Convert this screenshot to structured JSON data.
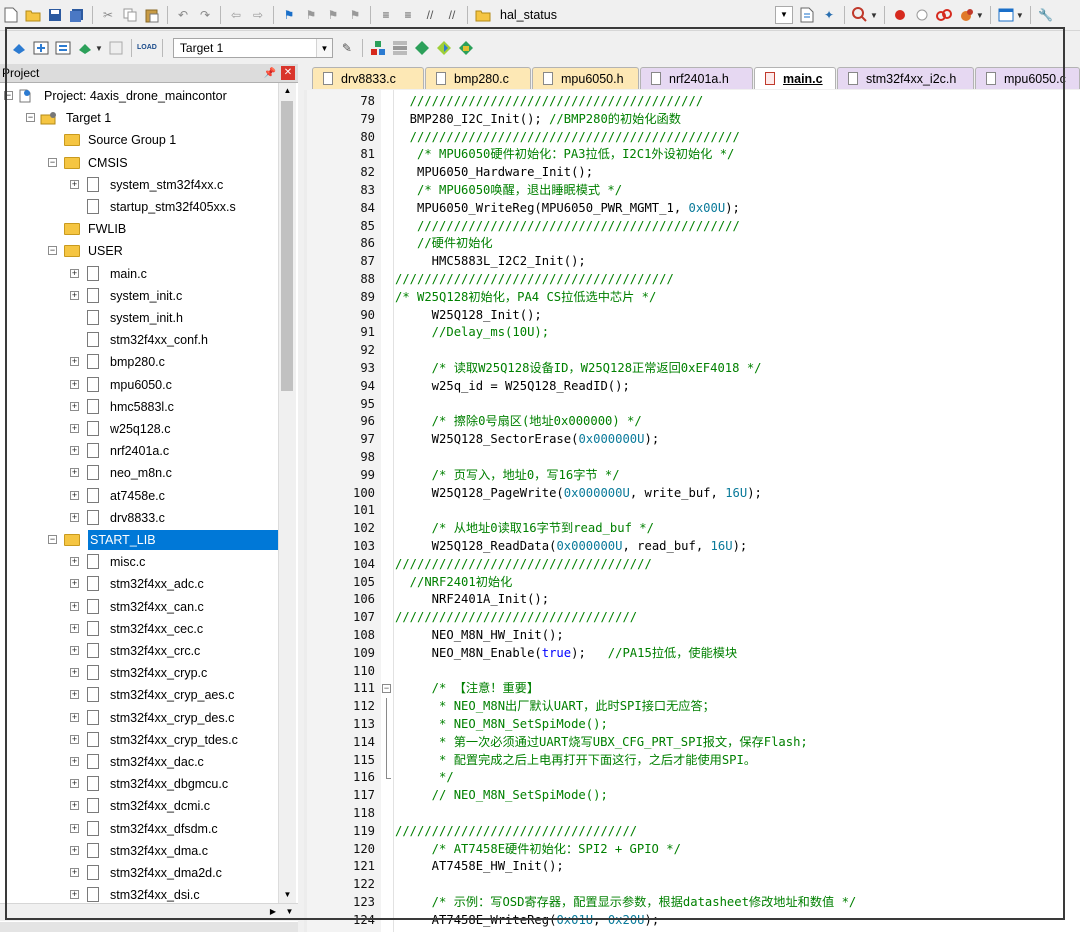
{
  "toolbar": {
    "search_value": "hal_status",
    "target_select": "Target 1"
  },
  "project_panel": {
    "title": "Project",
    "tree": [
      {
        "label": "Project: 4axis_drone_maincontor",
        "depth": 0,
        "type": "project",
        "expander": "-"
      },
      {
        "label": "Target 1",
        "depth": 1,
        "type": "target",
        "expander": "-"
      },
      {
        "label": "Source Group 1",
        "depth": 2,
        "type": "folder",
        "expander": ""
      },
      {
        "label": "CMSIS",
        "depth": 2,
        "type": "folder",
        "expander": "-"
      },
      {
        "label": "system_stm32f4xx.c",
        "depth": 3,
        "type": "file",
        "expander": "+"
      },
      {
        "label": "startup_stm32f405xx.s",
        "depth": 3,
        "type": "file",
        "expander": ""
      },
      {
        "label": "FWLIB",
        "depth": 2,
        "type": "folder",
        "expander": ""
      },
      {
        "label": "USER",
        "depth": 2,
        "type": "folder",
        "expander": "-"
      },
      {
        "label": "main.c",
        "depth": 3,
        "type": "file",
        "expander": "+"
      },
      {
        "label": "system_init.c",
        "depth": 3,
        "type": "file",
        "expander": "+"
      },
      {
        "label": "system_init.h",
        "depth": 3,
        "type": "file",
        "expander": ""
      },
      {
        "label": "stm32f4xx_conf.h",
        "depth": 3,
        "type": "file",
        "expander": ""
      },
      {
        "label": "bmp280.c",
        "depth": 3,
        "type": "file",
        "expander": "+"
      },
      {
        "label": "mpu6050.c",
        "depth": 3,
        "type": "file",
        "expander": "+"
      },
      {
        "label": "hmc5883l.c",
        "depth": 3,
        "type": "file",
        "expander": "+"
      },
      {
        "label": "w25q128.c",
        "depth": 3,
        "type": "file",
        "expander": "+"
      },
      {
        "label": "nrf2401a.c",
        "depth": 3,
        "type": "file",
        "expander": "+"
      },
      {
        "label": "neo_m8n.c",
        "depth": 3,
        "type": "file",
        "expander": "+"
      },
      {
        "label": "at7458e.c",
        "depth": 3,
        "type": "file",
        "expander": "+"
      },
      {
        "label": "drv8833.c",
        "depth": 3,
        "type": "file",
        "expander": "+"
      },
      {
        "label": "START_LIB",
        "depth": 2,
        "type": "folder",
        "expander": "-",
        "selected": true
      },
      {
        "label": "misc.c",
        "depth": 3,
        "type": "file",
        "expander": "+"
      },
      {
        "label": "stm32f4xx_adc.c",
        "depth": 3,
        "type": "file",
        "expander": "+"
      },
      {
        "label": "stm32f4xx_can.c",
        "depth": 3,
        "type": "file",
        "expander": "+"
      },
      {
        "label": "stm32f4xx_cec.c",
        "depth": 3,
        "type": "file",
        "expander": "+"
      },
      {
        "label": "stm32f4xx_crc.c",
        "depth": 3,
        "type": "file",
        "expander": "+"
      },
      {
        "label": "stm32f4xx_cryp.c",
        "depth": 3,
        "type": "file",
        "expander": "+"
      },
      {
        "label": "stm32f4xx_cryp_aes.c",
        "depth": 3,
        "type": "file",
        "expander": "+"
      },
      {
        "label": "stm32f4xx_cryp_des.c",
        "depth": 3,
        "type": "file",
        "expander": "+"
      },
      {
        "label": "stm32f4xx_cryp_tdes.c",
        "depth": 3,
        "type": "file",
        "expander": "+"
      },
      {
        "label": "stm32f4xx_dac.c",
        "depth": 3,
        "type": "file",
        "expander": "+"
      },
      {
        "label": "stm32f4xx_dbgmcu.c",
        "depth": 3,
        "type": "file",
        "expander": "+"
      },
      {
        "label": "stm32f4xx_dcmi.c",
        "depth": 3,
        "type": "file",
        "expander": "+"
      },
      {
        "label": "stm32f4xx_dfsdm.c",
        "depth": 3,
        "type": "file",
        "expander": "+"
      },
      {
        "label": "stm32f4xx_dma.c",
        "depth": 3,
        "type": "file",
        "expander": "+"
      },
      {
        "label": "stm32f4xx_dma2d.c",
        "depth": 3,
        "type": "file",
        "expander": "+"
      },
      {
        "label": "stm32f4xx_dsi.c",
        "depth": 3,
        "type": "file",
        "expander": "+"
      }
    ]
  },
  "tabs": [
    {
      "label": "drv8833.c",
      "kind": "c",
      "active": false
    },
    {
      "label": "bmp280.c",
      "kind": "c",
      "active": false
    },
    {
      "label": "mpu6050.h",
      "kind": "c",
      "active": false
    },
    {
      "label": "nrf2401a.h",
      "kind": "h",
      "active": false
    },
    {
      "label": "main.c",
      "kind": "c",
      "active": true
    },
    {
      "label": "stm32f4xx_i2c.h",
      "kind": "h",
      "active": false
    },
    {
      "label": "mpu6050.c",
      "kind": "h",
      "active": false
    }
  ],
  "editor": {
    "lines": [
      {
        "n": "78",
        "segs": [
          [
            "cm",
            "  ////////////////////////////////////////"
          ]
        ]
      },
      {
        "n": "79",
        "segs": [
          [
            "",
            "  BMP280_I2C_Init(); "
          ],
          [
            "cm",
            "//BMP280的初始化函数"
          ]
        ]
      },
      {
        "n": "80",
        "segs": [
          [
            "cm",
            "  /////////////////////////////////////////////"
          ]
        ]
      },
      {
        "n": "81",
        "segs": [
          [
            "cm",
            "   /* MPU6050硬件初始化：PA3拉低，I2C1外设初始化 */"
          ]
        ]
      },
      {
        "n": "82",
        "segs": [
          [
            "",
            "   MPU6050_Hardware_Init();"
          ]
        ]
      },
      {
        "n": "83",
        "segs": [
          [
            "cm",
            "   /* MPU6050唤醒，退出睡眠模式 */"
          ]
        ]
      },
      {
        "n": "84",
        "segs": [
          [
            "",
            "   MPU6050_WriteReg(MPU6050_PWR_MGMT_1, "
          ],
          [
            "num",
            "0x00U"
          ],
          [
            "",
            ");"
          ]
        ]
      },
      {
        "n": "85",
        "segs": [
          [
            "cm",
            "   ////////////////////////////////////////////"
          ]
        ]
      },
      {
        "n": "86",
        "segs": [
          [
            "cm",
            "   //硬件初始化"
          ]
        ]
      },
      {
        "n": "87",
        "segs": [
          [
            "",
            "     HMC5883L_I2C2_Init();"
          ]
        ]
      },
      {
        "n": "88",
        "segs": [
          [
            "cm",
            "//////////////////////////////////////"
          ]
        ]
      },
      {
        "n": "89",
        "segs": [
          [
            "cm",
            "/* W25Q128初始化，PA4 CS拉低选中芯片 */"
          ]
        ]
      },
      {
        "n": "90",
        "segs": [
          [
            "",
            "     W25Q128_Init();"
          ]
        ]
      },
      {
        "n": "91",
        "segs": [
          [
            "cm",
            "     //Delay_ms(10U);"
          ]
        ]
      },
      {
        "n": "92",
        "segs": [
          [
            "",
            ""
          ]
        ]
      },
      {
        "n": "93",
        "segs": [
          [
            "cm",
            "     /* 读取W25Q128设备ID，W25Q128正常返回0xEF4018 */"
          ]
        ]
      },
      {
        "n": "94",
        "segs": [
          [
            "",
            "     w25q_id = W25Q128_ReadID();"
          ]
        ]
      },
      {
        "n": "95",
        "segs": [
          [
            "",
            ""
          ]
        ]
      },
      {
        "n": "96",
        "segs": [
          [
            "cm",
            "     /* 擦除0号扇区(地址0x000000) */"
          ]
        ]
      },
      {
        "n": "97",
        "segs": [
          [
            "",
            "     W25Q128_SectorErase("
          ],
          [
            "num",
            "0x000000U"
          ],
          [
            "",
            ");"
          ]
        ]
      },
      {
        "n": "98",
        "segs": [
          [
            "",
            ""
          ]
        ]
      },
      {
        "n": "99",
        "segs": [
          [
            "cm",
            "     /* 页写入，地址0，写16字节 */"
          ]
        ]
      },
      {
        "n": "100",
        "segs": [
          [
            "",
            "     W25Q128_PageWrite("
          ],
          [
            "num",
            "0x000000U"
          ],
          [
            "",
            ", write_buf, "
          ],
          [
            "num",
            "16U"
          ],
          [
            "",
            ");"
          ]
        ]
      },
      {
        "n": "101",
        "segs": [
          [
            "",
            ""
          ]
        ]
      },
      {
        "n": "102",
        "segs": [
          [
            "cm",
            "     /* 从地址0读取16字节到read_buf */"
          ]
        ]
      },
      {
        "n": "103",
        "segs": [
          [
            "",
            "     W25Q128_ReadData("
          ],
          [
            "num",
            "0x000000U"
          ],
          [
            "",
            ", read_buf, "
          ],
          [
            "num",
            "16U"
          ],
          [
            "",
            ");"
          ]
        ]
      },
      {
        "n": "104",
        "segs": [
          [
            "cm",
            "///////////////////////////////////"
          ]
        ]
      },
      {
        "n": "105",
        "segs": [
          [
            "cm",
            "  //NRF2401初始化"
          ]
        ]
      },
      {
        "n": "106",
        "segs": [
          [
            "",
            "     NRF2401A_Init();"
          ]
        ]
      },
      {
        "n": "107",
        "segs": [
          [
            "cm",
            "/////////////////////////////////"
          ]
        ]
      },
      {
        "n": "108",
        "segs": [
          [
            "",
            "     NEO_M8N_HW_Init();"
          ]
        ]
      },
      {
        "n": "109",
        "segs": [
          [
            "",
            "     NEO_M8N_Enable("
          ],
          [
            "kw",
            "true"
          ],
          [
            "",
            ");   "
          ],
          [
            "cm",
            "//PA15拉低，使能模块"
          ]
        ]
      },
      {
        "n": "110",
        "segs": [
          [
            "",
            ""
          ]
        ]
      },
      {
        "n": "111",
        "segs": [
          [
            "cm",
            "     /* 【注意！重要】"
          ]
        ],
        "fold": "box"
      },
      {
        "n": "112",
        "segs": [
          [
            "cm",
            "      * NEO_M8N出厂默认UART，此时SPI接口无应答；"
          ]
        ],
        "fold": "line"
      },
      {
        "n": "113",
        "segs": [
          [
            "cm",
            "      * NEO_M8N_SetSpiMode();"
          ]
        ],
        "fold": "line"
      },
      {
        "n": "114",
        "segs": [
          [
            "cm",
            "      * 第一次必须通过UART烧写UBX_CFG_PRT_SPI报文，保存Flash;"
          ]
        ],
        "fold": "line"
      },
      {
        "n": "115",
        "segs": [
          [
            "cm",
            "      * 配置完成之后上电再打开下面这行，之后才能使用SPI。"
          ]
        ],
        "fold": "line"
      },
      {
        "n": "116",
        "segs": [
          [
            "cm",
            "      */"
          ]
        ],
        "fold": "end"
      },
      {
        "n": "117",
        "segs": [
          [
            "cm",
            "     // NEO_M8N_SetSpiMode();"
          ]
        ]
      },
      {
        "n": "118",
        "segs": [
          [
            "",
            ""
          ]
        ]
      },
      {
        "n": "119",
        "segs": [
          [
            "cm",
            "/////////////////////////////////"
          ]
        ]
      },
      {
        "n": "120",
        "segs": [
          [
            "cm",
            "     /* AT7458E硬件初始化：SPI2 + GPIO */"
          ]
        ]
      },
      {
        "n": "121",
        "segs": [
          [
            "",
            "     AT7458E_HW_Init();"
          ]
        ]
      },
      {
        "n": "122",
        "segs": [
          [
            "",
            ""
          ]
        ]
      },
      {
        "n": "123",
        "segs": [
          [
            "cm",
            "     /* 示例：写OSD寄存器，配置显示参数，根据datasheet修改地址和数值 */"
          ]
        ]
      },
      {
        "n": "124",
        "segs": [
          [
            "",
            "     AT7458E_WriteReg("
          ],
          [
            "num",
            "0x01U"
          ],
          [
            "",
            ", "
          ],
          [
            "num",
            "0x20U"
          ],
          [
            "",
            ");"
          ]
        ]
      }
    ]
  }
}
